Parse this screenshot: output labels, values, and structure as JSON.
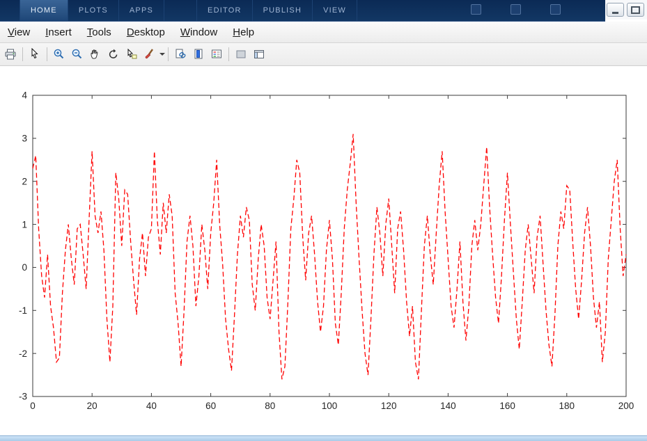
{
  "ribbon": {
    "tabs": [
      {
        "label": "HOME"
      },
      {
        "label": "PLOTS"
      },
      {
        "label": "APPS"
      },
      {
        "label": "EDITOR"
      },
      {
        "label": "PUBLISH"
      },
      {
        "label": "VIEW"
      }
    ]
  },
  "menubar": {
    "items": [
      {
        "u": "V",
        "rest": "iew"
      },
      {
        "u": "I",
        "rest": "nsert"
      },
      {
        "u": "T",
        "rest": "ools"
      },
      {
        "u": "D",
        "rest": "esktop"
      },
      {
        "u": "W",
        "rest": "indow"
      },
      {
        "u": "H",
        "rest": "elp"
      }
    ]
  },
  "toolbar": {
    "icons": [
      "print-icon",
      "arrow-cursor-icon",
      "zoom-in-icon",
      "zoom-out-icon",
      "pan-hand-icon",
      "rotate-3d-icon",
      "data-cursor-icon",
      "brush-icon",
      "brush-dropdown-chevron-icon",
      "link-plots-icon",
      "insert-colorbar-icon",
      "insert-legend-icon",
      "hide-plot-tools-icon",
      "show-plot-tools-icon"
    ]
  },
  "colors": {
    "ribbon_bg": "#0e2f5c",
    "line_red": "#ff0000",
    "bottom_bar": "#b9d4ee"
  },
  "chart_data": {
    "type": "line",
    "title": "",
    "xlabel": "",
    "ylabel": "",
    "xlim": [
      0,
      200
    ],
    "ylim": [
      -3,
      4
    ],
    "xticks": [
      0,
      20,
      40,
      60,
      80,
      100,
      120,
      140,
      160,
      180,
      200
    ],
    "yticks": [
      -3,
      -2,
      -1,
      0,
      1,
      2,
      3,
      4
    ],
    "grid": false,
    "legend": null,
    "line": {
      "color": "#ff0000",
      "style": "dashed",
      "width": 1.3
    },
    "x_step": 1,
    "values": [
      2.3,
      2.6,
      0.9,
      -0.2,
      -0.7,
      0.3,
      -0.9,
      -1.4,
      -2.2,
      -2.1,
      -0.6,
      0.4,
      1.0,
      0.2,
      -0.4,
      0.9,
      1.0,
      0.3,
      -0.5,
      1.1,
      2.7,
      1.2,
      0.8,
      1.3,
      0.4,
      -1.2,
      -2.2,
      -0.9,
      2.2,
      1.6,
      0.5,
      1.8,
      1.7,
      0.6,
      -0.3,
      -1.1,
      0.2,
      0.8,
      -0.2,
      0.7,
      0.9,
      2.7,
      1.1,
      0.3,
      1.5,
      0.8,
      1.7,
      1.2,
      -0.6,
      -1.3,
      -2.3,
      -1.0,
      0.6,
      1.2,
      0.5,
      -0.9,
      -0.2,
      1.0,
      0.4,
      -0.5,
      0.8,
      1.5,
      2.5,
      1.0,
      0.1,
      -1.2,
      -1.9,
      -2.4,
      -1.1,
      0.3,
      1.2,
      0.7,
      1.4,
      1.1,
      -0.4,
      -1.0,
      0.2,
      1.0,
      0.5,
      -0.7,
      -1.2,
      -0.3,
      0.6,
      -1.5,
      -2.6,
      -2.3,
      -0.8,
      0.9,
      1.6,
      2.5,
      2.2,
      0.7,
      -0.3,
      0.8,
      1.2,
      0.3,
      -0.8,
      -1.5,
      -0.9,
      0.4,
      1.1,
      0.2,
      -1.3,
      -1.8,
      -0.6,
      0.9,
      1.8,
      2.4,
      3.1,
      1.5,
      0.2,
      -1.0,
      -2.0,
      -2.5,
      -1.2,
      0.3,
      1.4,
      0.8,
      -0.2,
      1.0,
      1.6,
      0.5,
      -0.6,
      0.9,
      1.3,
      0.4,
      -0.8,
      -1.6,
      -0.9,
      -2.2,
      -2.6,
      -1.0,
      0.5,
      1.2,
      0.3,
      -0.4,
      0.8,
      1.9,
      2.7,
      1.3,
      0.2,
      -0.9,
      -1.4,
      -0.5,
      0.6,
      -0.8,
      -1.7,
      -0.9,
      0.5,
      1.1,
      0.4,
      1.0,
      1.9,
      2.8,
      1.4,
      0.3,
      -0.7,
      -1.3,
      -0.2,
      1.1,
      2.2,
      1.0,
      -0.1,
      -1.2,
      -1.9,
      -0.8,
      0.4,
      1.0,
      0.2,
      -0.6,
      0.7,
      1.2,
      0.1,
      -1.0,
      -1.8,
      -2.3,
      -1.1,
      0.5,
      1.3,
      0.9,
      1.9,
      1.8,
      0.6,
      -0.5,
      -1.2,
      -0.3,
      0.8,
      1.4,
      0.5,
      -0.7,
      -1.4,
      -0.8,
      -2.2,
      -1.5,
      0.2,
      1.1,
      2.0,
      2.5,
      0.9,
      -0.2,
      0.3
    ]
  }
}
